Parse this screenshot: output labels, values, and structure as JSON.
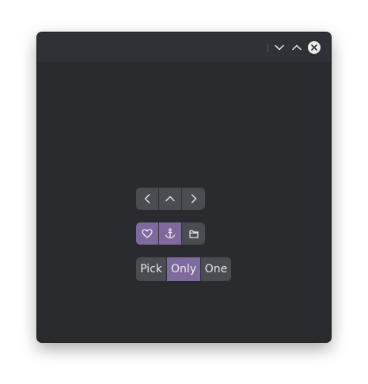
{
  "window": {
    "controls": {
      "minimize_icon": "chevron-down-icon",
      "maximize_icon": "chevron-up-icon",
      "close_icon": "close-icon"
    }
  },
  "nav_group": {
    "buttons": [
      {
        "icon": "chevron-left-icon"
      },
      {
        "icon": "chevron-up-icon"
      },
      {
        "icon": "chevron-right-icon"
      }
    ]
  },
  "toggle_group": {
    "buttons": [
      {
        "icon": "heart-icon",
        "active": true
      },
      {
        "icon": "anchor-icon",
        "active": true
      },
      {
        "icon": "folder-icon",
        "active": false
      }
    ]
  },
  "choice_group": {
    "options": [
      {
        "label": "Pick",
        "active": false
      },
      {
        "label": "Only",
        "active": true
      },
      {
        "label": "One",
        "active": false
      }
    ]
  },
  "colors": {
    "window_bg": "#2a2b2f",
    "headerbar_bg": "#303136",
    "button_bg": "#4a4c52",
    "accent": "#7e6a9c"
  }
}
